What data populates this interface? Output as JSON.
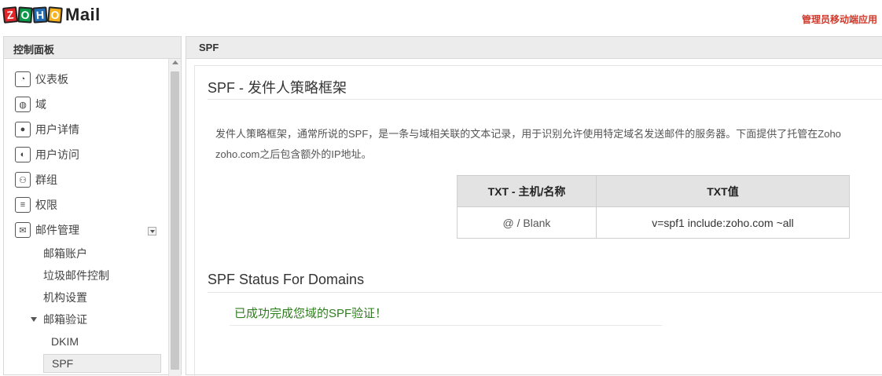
{
  "brand": {
    "letters": [
      "Z",
      "O",
      "H",
      "O"
    ],
    "product": "Mail"
  },
  "header": {
    "admin_link": "管理员移动端应用"
  },
  "sidebar": {
    "title": "控制面板",
    "items": [
      {
        "label": "仪表板",
        "icon": "dashboard-icon"
      },
      {
        "label": "域",
        "icon": "globe-icon"
      },
      {
        "label": "用户详情",
        "icon": "user-icon"
      },
      {
        "label": "用户访问",
        "icon": "user-access-icon"
      },
      {
        "label": "群组",
        "icon": "group-icon"
      },
      {
        "label": "权限",
        "icon": "document-icon"
      },
      {
        "label": "邮件管理",
        "icon": "mail-icon"
      }
    ],
    "mail_sub": [
      "邮箱账户",
      "垃圾邮件控制",
      "机构设置"
    ],
    "verify_group": "邮箱验证",
    "verify_sub": [
      "DKIM",
      "SPF"
    ]
  },
  "main": {
    "header": "SPF",
    "section1_title": "SPF - 发件人策略框架",
    "description_line1": "发件人策略框架，通常所说的SPF，是一条与域相关联的文本记录，用于识别允许使用特定域名发送邮件的服务器。下面提供了托管在Zoho",
    "description_line2": "zoho.com之后包含额外的IP地址。",
    "table": {
      "headers": [
        "TXT - 主机/名称",
        "TXT值"
      ],
      "rows": [
        [
          "@ / Blank",
          "v=spf1 include:zoho.com ~all"
        ]
      ]
    },
    "section2_title": "SPF Status For Domains",
    "status_message": "已成功完成您域的SPF验证！"
  },
  "colors": {
    "accent_red": "#d0392b",
    "success_green": "#2e7d1e",
    "header_gray": "#ececec"
  }
}
